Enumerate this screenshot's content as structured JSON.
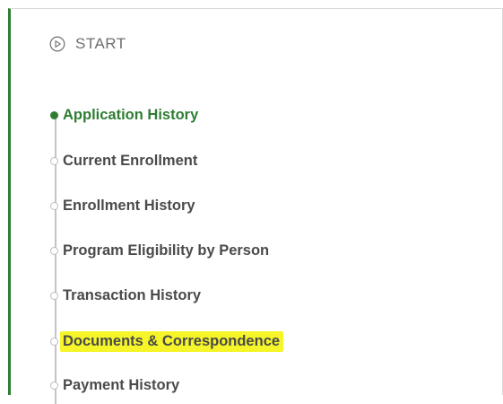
{
  "start": {
    "label": "START",
    "icon": "play-circle-icon"
  },
  "nav": {
    "items": [
      {
        "label": "Application History",
        "active": true
      },
      {
        "label": "Current Enrollment",
        "active": false
      },
      {
        "label": "Enrollment History",
        "active": false
      },
      {
        "label": "Program Eligibility by Person",
        "active": false
      },
      {
        "label": "Transaction History",
        "active": false
      },
      {
        "label": "Documents & Correspondence",
        "active": false,
        "highlighted": true
      },
      {
        "label": "Payment History",
        "active": false
      }
    ]
  },
  "colors": {
    "accent": "#2e7d32",
    "highlight": "#f5f52a",
    "text": "#4a4a4a",
    "muted": "#6f6f6f"
  }
}
